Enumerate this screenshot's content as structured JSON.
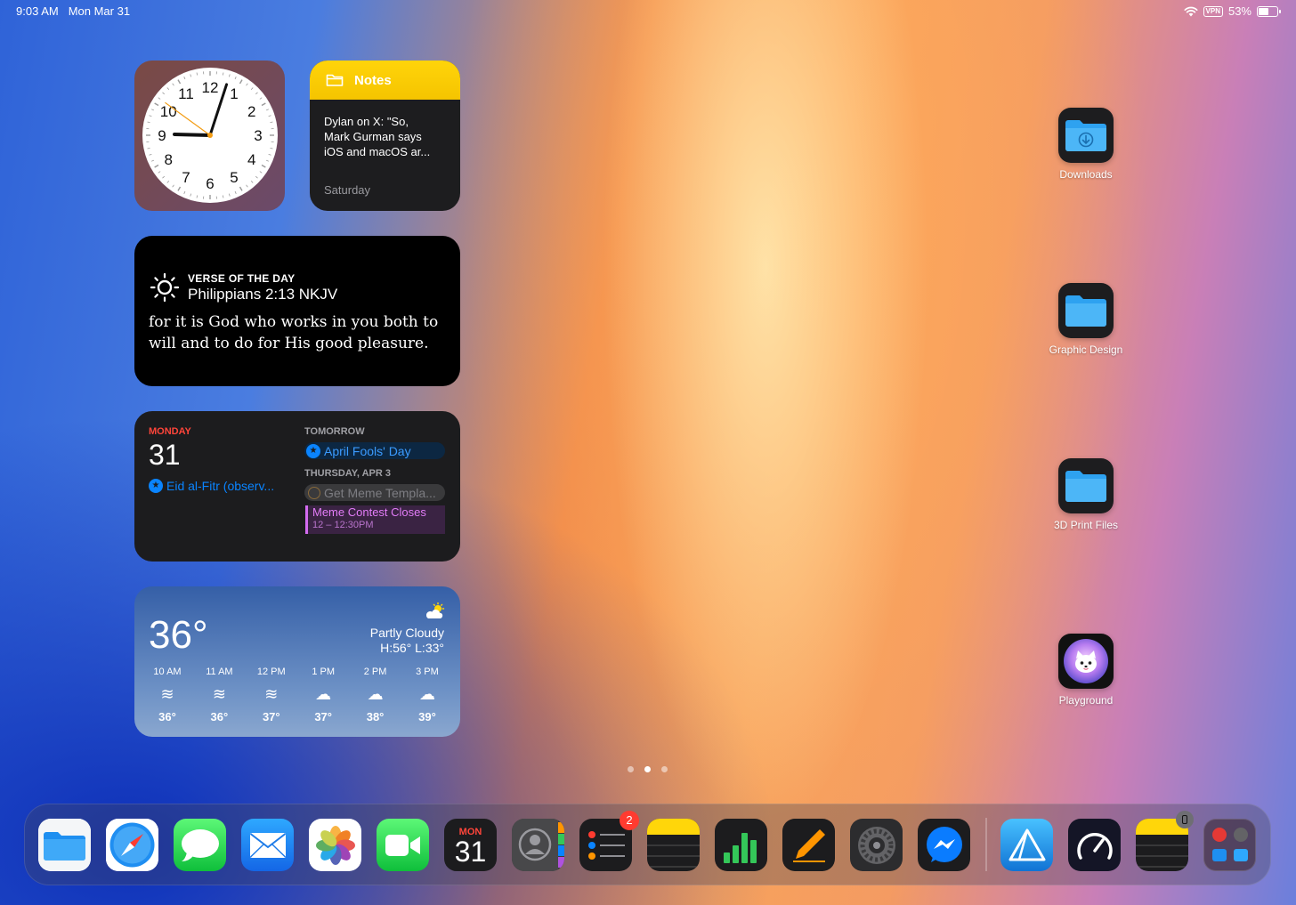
{
  "status_bar": {
    "time": "9:03 AM",
    "date": "Mon Mar 31",
    "vpn": "VPN",
    "battery": "53%",
    "battery_level": 0.53
  },
  "clock_widget": {
    "numerals": [
      "12",
      "1",
      "2",
      "3",
      "4",
      "5",
      "6",
      "7",
      "8",
      "9",
      "10",
      "11"
    ],
    "time": "9:03"
  },
  "notes_widget": {
    "title": "Notes",
    "preview_line1": "Dylan on X: \"So,",
    "preview_line2": "Mark Gurman says",
    "preview_line3": "iOS and macOS ar...",
    "date": "Saturday"
  },
  "verse_widget": {
    "kicker": "VERSE OF THE DAY",
    "reference": "Philippians 2:13 NKJV",
    "text": "for it is God who works in you both to will and to do for His good pleasure."
  },
  "calendar_widget": {
    "day_name": "MONDAY",
    "day_number": "31",
    "today_event": "Eid al-Fitr (observ...",
    "tomorrow_label": "TOMORROW",
    "tomorrow_event": "April Fools' Day",
    "thursday_label": "THURSDAY, APR 3",
    "reminder": "Get Meme Templa...",
    "event_title": "Meme Contest Closes",
    "event_time": "12 – 12:30PM"
  },
  "weather_widget": {
    "temperature": "36°",
    "condition": "Partly Cloudy",
    "high_low": "H:56° L:33°",
    "hours": [
      {
        "time": "10 AM",
        "icon": "wind-icon",
        "temp": "36°"
      },
      {
        "time": "11 AM",
        "icon": "wind-icon",
        "temp": "36°"
      },
      {
        "time": "12 PM",
        "icon": "wind-icon",
        "temp": "37°"
      },
      {
        "time": "1 PM",
        "icon": "cloud-icon",
        "temp": "37°"
      },
      {
        "time": "2 PM",
        "icon": "cloud-icon",
        "temp": "38°"
      },
      {
        "time": "3 PM",
        "icon": "cloud-icon",
        "temp": "39°"
      }
    ]
  },
  "desktop": {
    "items": [
      {
        "label": "Downloads",
        "icon": "downloads-folder-icon"
      },
      {
        "label": "Graphic Design",
        "icon": "folder-icon"
      },
      {
        "label": "3D Print Files",
        "icon": "folder-icon"
      },
      {
        "label": "Playground",
        "icon": "playground-icon"
      }
    ]
  },
  "page_indicator": {
    "pages": 3,
    "current": 2
  },
  "dock": {
    "apps": [
      {
        "name": "Files",
        "icon": "files-icon"
      },
      {
        "name": "Safari",
        "icon": "safari-icon"
      },
      {
        "name": "Messages",
        "icon": "messages-icon"
      },
      {
        "name": "Mail",
        "icon": "mail-icon"
      },
      {
        "name": "Photos",
        "icon": "photos-icon"
      },
      {
        "name": "FaceTime",
        "icon": "facetime-icon"
      },
      {
        "name": "Calendar",
        "icon": "calendar-icon",
        "month": "MON",
        "day": "31"
      },
      {
        "name": "Contacts",
        "icon": "contacts-icon"
      },
      {
        "name": "Reminders",
        "icon": "reminders-icon",
        "badge": "2"
      },
      {
        "name": "Notes",
        "icon": "notes-icon"
      },
      {
        "name": "Numbers",
        "icon": "numbers-icon"
      },
      {
        "name": "Pages",
        "icon": "pages-icon"
      },
      {
        "name": "Settings",
        "icon": "settings-icon"
      },
      {
        "name": "Messenger",
        "icon": "messenger-icon"
      },
      {
        "name": "Affinity Designer",
        "icon": "affinity-icon"
      },
      {
        "name": "Speedtest",
        "icon": "speedtest-icon"
      },
      {
        "name": "Notes",
        "icon": "notes-icon"
      },
      {
        "name": "App Library",
        "icon": "app-library-icon"
      }
    ]
  },
  "colors": {
    "calendar_red": "#ff453a",
    "calendar_blue": "#0a84ff",
    "event_purple": "#d36bf0",
    "notes_yellow": "#ffd40a"
  }
}
